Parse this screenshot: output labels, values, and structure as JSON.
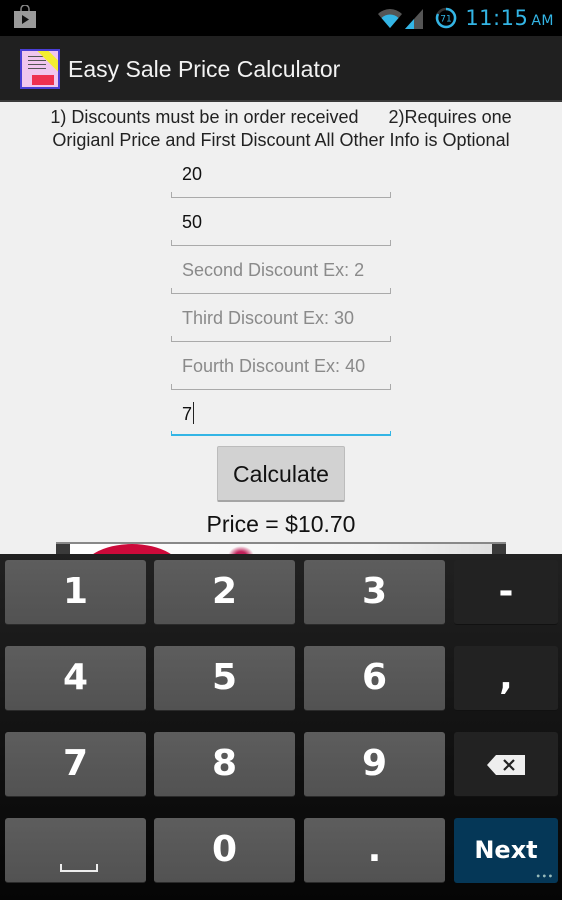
{
  "status_bar": {
    "time": "11:15",
    "ampm": "AM",
    "battery_level": "71",
    "icons": [
      "play-store-icon",
      "wifi-icon",
      "signal-icon",
      "battery-icon"
    ],
    "accent_color": "#33b5e5"
  },
  "action_bar": {
    "title": "Easy Sale Price Calculator",
    "icon": "app-icon"
  },
  "instructions": {
    "line1": "1) Discounts must be in order received      2)Requires one",
    "line2": "Origianl Price and First Discount All Other Info is Optional"
  },
  "fields": [
    {
      "name": "original-price",
      "value": "20",
      "placeholder": ""
    },
    {
      "name": "first-discount",
      "value": "50",
      "placeholder": ""
    },
    {
      "name": "second-discount",
      "value": "",
      "placeholder": "Second Discount Ex: 2"
    },
    {
      "name": "third-discount",
      "value": "",
      "placeholder": "Third Discount Ex: 30"
    },
    {
      "name": "fourth-discount",
      "value": "",
      "placeholder": "Fourth Discount Ex: 40"
    },
    {
      "name": "tax",
      "value": "7",
      "placeholder": "",
      "focused": true
    }
  ],
  "calculate_button": "Calculate",
  "result": "Price = $10.70",
  "keyboard": {
    "rows": [
      [
        "1",
        "2",
        "3",
        "-"
      ],
      [
        "4",
        "5",
        "6",
        ","
      ],
      [
        "7",
        "8",
        "9",
        "backspace"
      ],
      [
        "space",
        "0",
        ".",
        "Next"
      ]
    ],
    "next_label": "Next",
    "next_color": "#053757"
  }
}
